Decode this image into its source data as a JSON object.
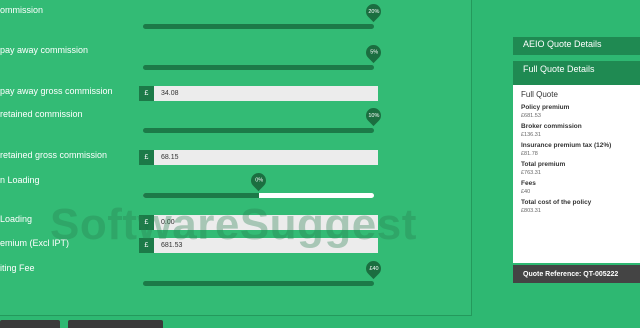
{
  "form": {
    "rows": [
      {
        "label": "ommission",
        "type": "slider",
        "badge": "20%",
        "fraction": 1.0
      },
      {
        "label": "pay away commission",
        "type": "slider",
        "badge": "5%",
        "fraction": 1.0
      },
      {
        "label": "pay away gross commission",
        "type": "money",
        "currency": "£",
        "value": "34.08"
      },
      {
        "label": "retained commission",
        "type": "slider",
        "badge": "10%",
        "fraction": 1.0
      },
      {
        "label": "retained gross commission",
        "type": "money",
        "currency": "£",
        "value": "68.15"
      },
      {
        "label": "n Loading",
        "type": "slider",
        "badge": "0%",
        "fraction": 0.5
      },
      {
        "label": "Loading",
        "type": "money",
        "currency": "£",
        "value": "0.00"
      },
      {
        "label": "emium (Excl IPT)",
        "type": "money",
        "currency": "£",
        "value": "681.53"
      },
      {
        "label": "iting Fee",
        "type": "slider",
        "badge": "£40",
        "fraction": 1.0
      }
    ]
  },
  "sidebar": {
    "aeio_tab": "AEIO Quote Details",
    "full_tab": "Full Quote Details",
    "card_heading": "Full Quote",
    "items": [
      {
        "label": "Policy premium",
        "amount": "£681.53"
      },
      {
        "label": "Broker commission",
        "amount": "£136.31"
      },
      {
        "label": "Insurance premium tax (12%)",
        "amount": "£81.78"
      },
      {
        "label": "Total premium",
        "amount": "£763.31"
      },
      {
        "label": "Fees",
        "amount": "£40"
      },
      {
        "label": "Total cost of the policy",
        "amount": "£803.31"
      }
    ],
    "reference": "Quote Reference: QT-005222"
  },
  "watermark": "SoftwareSuggest"
}
